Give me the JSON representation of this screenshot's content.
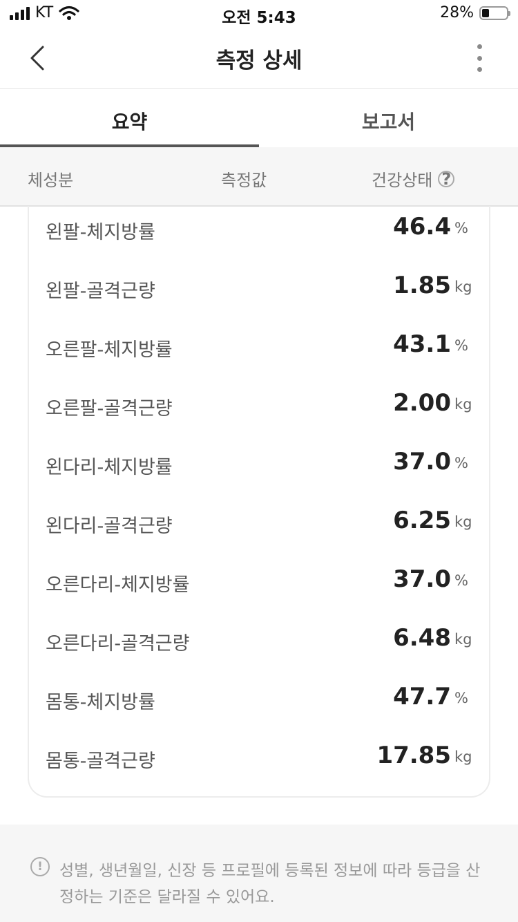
{
  "status_bar": {
    "carrier": "KT",
    "time": "오전 5:43",
    "battery": "28%"
  },
  "nav": {
    "title": "측정 상세",
    "back_icon": "chevron-left-icon",
    "more_icon": "more-vertical-icon"
  },
  "tabs": [
    {
      "label": "요약",
      "active": true
    },
    {
      "label": "보고서",
      "active": false
    }
  ],
  "table_header": {
    "col1": "체성분",
    "col2": "측정값",
    "col3": "건강상태",
    "help_icon": "question-circle-icon"
  },
  "rows": [
    {
      "label": "왼팔-체지방률",
      "value": "46.4",
      "unit": "%"
    },
    {
      "label": "왼팔-골격근량",
      "value": "1.85",
      "unit": "kg"
    },
    {
      "label": "오른팔-체지방률",
      "value": "43.1",
      "unit": "%"
    },
    {
      "label": "오른팔-골격근량",
      "value": "2.00",
      "unit": "kg"
    },
    {
      "label": "왼다리-체지방률",
      "value": "37.0",
      "unit": "%"
    },
    {
      "label": "왼다리-골격근량",
      "value": "6.25",
      "unit": "kg"
    },
    {
      "label": "오른다리-체지방률",
      "value": "37.0",
      "unit": "%"
    },
    {
      "label": "오른다리-골격근량",
      "value": "6.48",
      "unit": "kg"
    },
    {
      "label": "몸통-체지방률",
      "value": "47.7",
      "unit": "%"
    },
    {
      "label": "몸통-골격근량",
      "value": "17.85",
      "unit": "kg"
    }
  ],
  "notice": {
    "icon": "exclamation-circle-icon",
    "text": "성별, 생년월일, 신장 등 프로필에 등록된 정보에 따라 등급을 산정하는 기준은 달라질 수 있어요."
  }
}
